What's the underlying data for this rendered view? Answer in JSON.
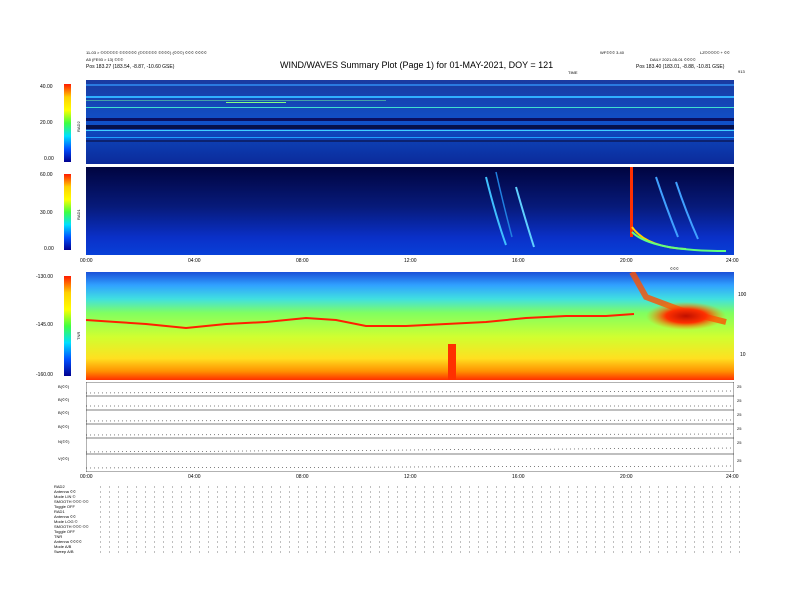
{
  "header": {
    "title": "WIND/WAVES Summary Plot (Page 1) for 01-MAY-2021, DOY = 121",
    "left_line1": "11-03 > ©©©©©© ©©©©©© (©©©©©© ©©©©) (©©©) ©©© ©©©©",
    "left_line2": "A5 (FE93 > 13) ©©©",
    "left_pos": "Pos   183.27 (183.54, -8.87, -10.60 GSE)",
    "center_top": "WF©©© 3.40",
    "center_sub": "TIME",
    "right_top": "LZ©©©©© + ©©",
    "right_line2": "DAILY 2021-05-01 ©©©©",
    "right_pos": "Pos   183.40 (183.01, -8.88, -10.81 GSE)",
    "right_corner": "913"
  },
  "panels": {
    "rad2": {
      "label": "RAD2",
      "ticks": [
        "40.00",
        "20.00",
        "0.00"
      ]
    },
    "rad1": {
      "label": "RAD1",
      "ticks": [
        "60.00",
        "30.00",
        "0.00"
      ]
    },
    "tnr": {
      "label": "TNR",
      "ticks": [
        "-130.00",
        "-145.00",
        "-160.00"
      ],
      "right_ticks": [
        "100",
        "10"
      ],
      "corner_label": "©©©"
    }
  },
  "time_axis": [
    "00:00",
    "04:00",
    "08:00",
    "12:00",
    "16:00",
    "20:00",
    "24:00"
  ],
  "timeline_rows": [
    {
      "label": "B(©©)",
      "right": "25"
    },
    {
      "label": "B(©©)",
      "right": "25"
    },
    {
      "label": "B(©©)",
      "right": "25"
    },
    {
      "label": "B(©©)",
      "right": "25"
    },
    {
      "label": "N(©©)",
      "right": "25"
    },
    {
      "label": "V(©©)",
      "right": "25"
    }
  ],
  "status_block": [
    "RAD2",
    "Antenna   ©©",
    "Mode    LIN ©",
    "SMOOTH ©©©   ©©",
    "Toggle    OFF",
    "RAD1",
    "Antenna   ©©",
    "Mode   LOG ©",
    "SMOOTH ©©©   ©©",
    "Toggle    OFF",
    "TNR",
    "Antenna  ©©©©",
    "Mode    A/B",
    "Sweep    A/B"
  ],
  "colors": {
    "bg": "#ffffff",
    "deep_blue": "#0a1a9a",
    "hot": "#ff2000"
  }
}
